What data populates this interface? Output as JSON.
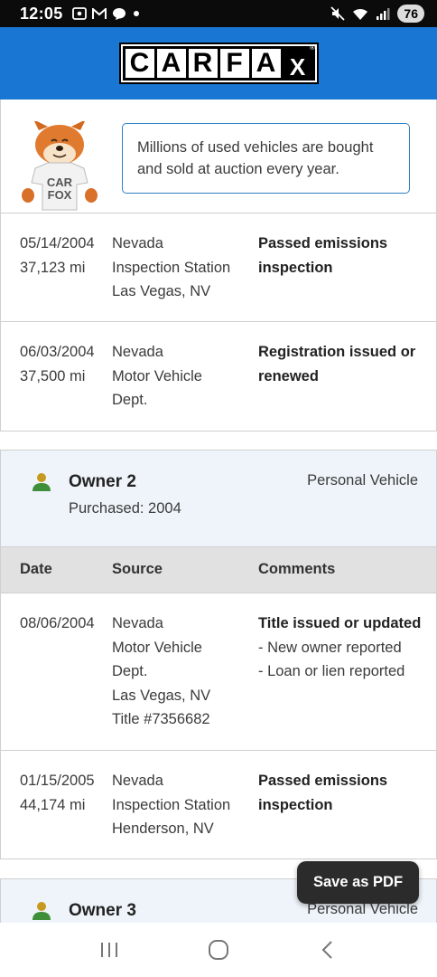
{
  "status_bar": {
    "time": "12:05",
    "battery": "76",
    "left_icons": [
      "screenshot-icon",
      "gmail-icon",
      "messages-icon",
      "dot-icon"
    ],
    "right_icons": [
      "mute-icon",
      "wifi-icon",
      "signal-icon",
      "battery-icon"
    ]
  },
  "header": {
    "logo_letters": [
      "C",
      "A",
      "R",
      "F",
      "A",
      "X"
    ],
    "registered_mark": "®",
    "bg_color": "#1976d2"
  },
  "fox_tip": {
    "shirt_text_line1": "CAR",
    "shirt_text_line2": "FOX",
    "message": "Millions of used vehicles are bought and sold at auction every year."
  },
  "records_owner1": [
    {
      "date": "05/14/2004",
      "mileage": "37,123 mi",
      "source": [
        "Nevada",
        "Inspection Station",
        "Las Vegas, NV"
      ],
      "comment_title": "Passed emissions inspection",
      "comment_details": []
    },
    {
      "date": "06/03/2004",
      "mileage": "37,500 mi",
      "source": [
        "Nevada",
        "Motor Vehicle",
        "Dept."
      ],
      "comment_title": "Registration issued or renewed",
      "comment_details": []
    }
  ],
  "owner2": {
    "title": "Owner 2",
    "purchased": "Purchased: 2004",
    "type": "Personal Vehicle"
  },
  "table_headers": {
    "date": "Date",
    "source": "Source",
    "comments": "Comments"
  },
  "records_owner2": [
    {
      "date": "08/06/2004",
      "mileage": "",
      "source": [
        "Nevada",
        "Motor Vehicle",
        "Dept.",
        "Las Vegas, NV",
        "Title #7356682"
      ],
      "comment_title": "Title issued or updated",
      "comment_details": [
        "- New owner reported",
        "- Loan or lien reported"
      ]
    },
    {
      "date": "01/15/2005",
      "mileage": "44,174 mi",
      "source": [
        "Nevada",
        "Inspection Station",
        "Henderson, NV"
      ],
      "comment_title": "Passed emissions inspection",
      "comment_details": []
    }
  ],
  "owner3": {
    "title": "Owner 3",
    "type": "Personal Vehicle"
  },
  "save_pdf_label": "Save as PDF",
  "nav": {
    "icons": [
      "recent-apps-icon",
      "home-icon",
      "back-icon"
    ]
  }
}
